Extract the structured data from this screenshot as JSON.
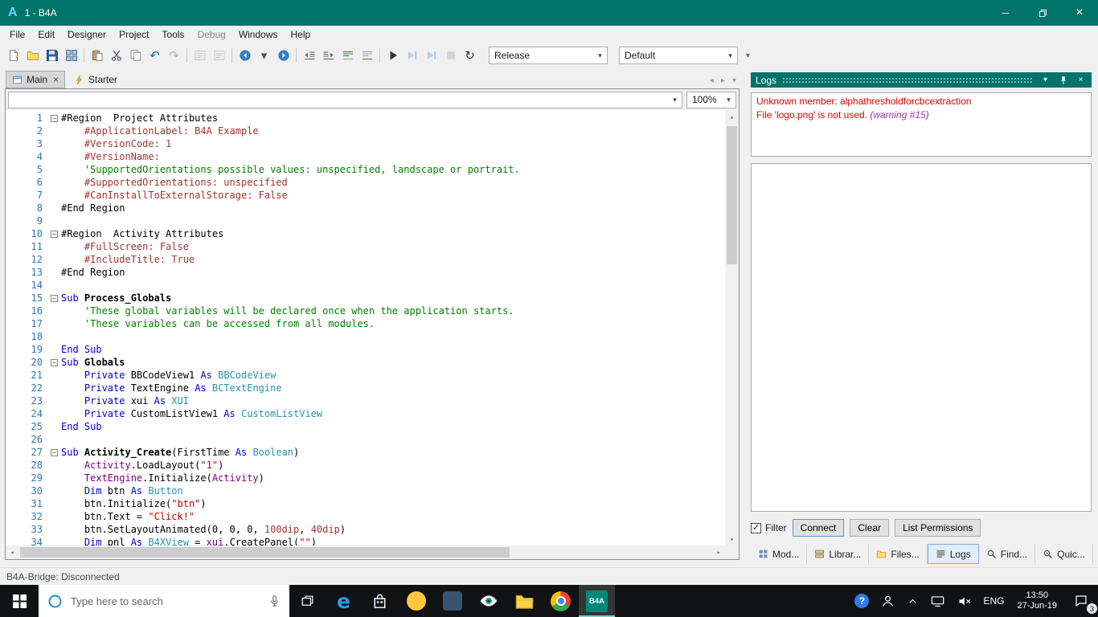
{
  "window": {
    "logo_letter": "A",
    "title": "1 - B4A"
  },
  "menubar": {
    "items": [
      {
        "label": "File"
      },
      {
        "label": "Edit"
      },
      {
        "label": "Designer"
      },
      {
        "label": "Project"
      },
      {
        "label": "Tools"
      },
      {
        "label": "Debug",
        "dim": true
      },
      {
        "label": "Windows"
      },
      {
        "label": "Help"
      }
    ]
  },
  "toolbar": {
    "items": [
      {
        "name": "new-module-button",
        "icon": "page"
      },
      {
        "name": "open-project-button",
        "icon": "folder"
      },
      {
        "name": "save-button",
        "icon": "floppy"
      },
      {
        "name": "save-all-button",
        "icon": "grid"
      },
      {
        "sep": true
      },
      {
        "name": "paste-button",
        "icon": "paste"
      },
      {
        "name": "cut-button",
        "icon": "cut"
      },
      {
        "name": "copy-button",
        "icon": "copy"
      },
      {
        "name": "undo-button",
        "glyph": "↶",
        "color": "#1565C0"
      },
      {
        "name": "redo-button",
        "glyph": "↷",
        "color": "#A9B4C0"
      },
      {
        "sep": true
      },
      {
        "name": "find-button",
        "icon": "findbook",
        "dim": true
      },
      {
        "name": "replace-button",
        "icon": "findbook",
        "dim": true
      },
      {
        "sep": true
      },
      {
        "name": "navigate-back-button",
        "icon": "back"
      },
      {
        "name": "navigate-back-menu",
        "glyph": "▾",
        "color": "#555555"
      },
      {
        "name": "navigate-forward-button",
        "icon": "forward"
      },
      {
        "sep": true
      },
      {
        "name": "outdent-button",
        "icon": "outdent"
      },
      {
        "name": "indent-button",
        "icon": "indent"
      },
      {
        "name": "comment-button",
        "icon": "comment"
      },
      {
        "name": "uncomment-button",
        "icon": "uncomment"
      },
      {
        "sep": true
      },
      {
        "name": "run-button",
        "icon": "play"
      },
      {
        "name": "resume-button",
        "icon": "resume",
        "dim": true
      },
      {
        "name": "step-button",
        "icon": "resume",
        "dim": true
      },
      {
        "name": "stop-button",
        "icon": "stop",
        "dim": true
      },
      {
        "name": "rebuild-button",
        "glyph": "↻",
        "color": "#333333"
      }
    ],
    "release_value": "Release",
    "default_value": "Default"
  },
  "tabs": {
    "items": [
      {
        "label": "Main",
        "active": true,
        "icon": "formicon",
        "close": true
      },
      {
        "label": "Starter",
        "active": false,
        "icon": "lightning"
      }
    ]
  },
  "editor": {
    "nav_value": "",
    "zoom": "100%",
    "lines": [
      {
        "n": 1,
        "fold": true,
        "t": [
          [
            "p",
            "#Region  Project Attributes"
          ]
        ]
      },
      {
        "n": 2,
        "t": [
          [
            "a",
            "    #ApplicationLabel: B4A Example"
          ]
        ]
      },
      {
        "n": 3,
        "t": [
          [
            "a",
            "    #VersionCode: 1"
          ]
        ]
      },
      {
        "n": 4,
        "t": [
          [
            "a",
            "    #VersionName: "
          ]
        ]
      },
      {
        "n": 5,
        "t": [
          [
            "c",
            "    'SupportedOrientations possible values: unspecified, landscape or portrait."
          ]
        ]
      },
      {
        "n": 6,
        "t": [
          [
            "a",
            "    #SupportedOrientations: unspecified"
          ]
        ]
      },
      {
        "n": 7,
        "t": [
          [
            "a",
            "    #CanInstallToExternalStorage: False"
          ]
        ]
      },
      {
        "n": 8,
        "t": [
          [
            "p",
            "#End Region"
          ]
        ]
      },
      {
        "n": 9,
        "t": []
      },
      {
        "n": 10,
        "fold": true,
        "t": [
          [
            "p",
            "#Region  Activity Attributes"
          ]
        ]
      },
      {
        "n": 11,
        "t": [
          [
            "a",
            "    #FullScreen: False"
          ]
        ]
      },
      {
        "n": 12,
        "t": [
          [
            "a",
            "    #IncludeTitle: True"
          ]
        ]
      },
      {
        "n": 13,
        "t": [
          [
            "p",
            "#End Region"
          ]
        ]
      },
      {
        "n": 14,
        "t": []
      },
      {
        "n": 15,
        "fold": true,
        "t": [
          [
            "k",
            "Sub "
          ],
          [
            "b",
            "Process_Globals"
          ]
        ]
      },
      {
        "n": 16,
        "t": [
          [
            "c",
            "    'These global variables will be declared once when the application starts."
          ]
        ]
      },
      {
        "n": 17,
        "t": [
          [
            "c",
            "    'These variables can be accessed from all modules."
          ]
        ]
      },
      {
        "n": 18,
        "t": []
      },
      {
        "n": 19,
        "t": [
          [
            "k",
            "End Sub"
          ]
        ]
      },
      {
        "n": 20,
        "fold": true,
        "t": [
          [
            "k",
            "Sub "
          ],
          [
            "b",
            "Globals"
          ]
        ]
      },
      {
        "n": 21,
        "t": [
          [
            "k",
            "    Private "
          ],
          [
            "p",
            "BBCodeView1 "
          ],
          [
            "k",
            "As "
          ],
          [
            "t",
            "BBCodeView"
          ]
        ]
      },
      {
        "n": 22,
        "t": [
          [
            "k",
            "    Private "
          ],
          [
            "p",
            "TextEngine "
          ],
          [
            "k",
            "As "
          ],
          [
            "t",
            "BCTextEngine"
          ]
        ]
      },
      {
        "n": 23,
        "t": [
          [
            "k",
            "    Private "
          ],
          [
            "p",
            "xui "
          ],
          [
            "k",
            "As "
          ],
          [
            "t",
            "XUI"
          ]
        ]
      },
      {
        "n": 24,
        "t": [
          [
            "k",
            "    Private "
          ],
          [
            "p",
            "CustomListView1 "
          ],
          [
            "k",
            "As "
          ],
          [
            "t",
            "CustomListView"
          ]
        ]
      },
      {
        "n": 25,
        "t": [
          [
            "k",
            "End Sub"
          ]
        ]
      },
      {
        "n": 26,
        "t": []
      },
      {
        "n": 27,
        "fold": true,
        "t": [
          [
            "k",
            "Sub "
          ],
          [
            "b",
            "Activity_Create"
          ],
          [
            "p",
            "(FirstTime "
          ],
          [
            "k",
            "As "
          ],
          [
            "t",
            "Boolean"
          ],
          [
            "p",
            ")"
          ]
        ]
      },
      {
        "n": 28,
        "t": [
          [
            "o",
            "    Activity"
          ],
          [
            "p",
            ".LoadLayout("
          ],
          [
            "s",
            "\"1\""
          ],
          [
            "p",
            ")"
          ]
        ]
      },
      {
        "n": 29,
        "t": [
          [
            "o",
            "    TextEngine"
          ],
          [
            "p",
            ".Initialize("
          ],
          [
            "o",
            "Activity"
          ],
          [
            "p",
            ")"
          ]
        ]
      },
      {
        "n": 30,
        "t": [
          [
            "k",
            "    Dim "
          ],
          [
            "p",
            "btn "
          ],
          [
            "k",
            "As "
          ],
          [
            "t",
            "Button"
          ]
        ]
      },
      {
        "n": 31,
        "t": [
          [
            "p",
            "    btn.Initialize("
          ],
          [
            "s",
            "\"btn\""
          ],
          [
            "p",
            ")"
          ]
        ]
      },
      {
        "n": 32,
        "t": [
          [
            "p",
            "    btn.Text = "
          ],
          [
            "s",
            "\"Click!\""
          ]
        ]
      },
      {
        "n": 33,
        "t": [
          [
            "p",
            "    btn.SetLayoutAnimated(0, 0, 0, "
          ],
          [
            "num",
            "100dip"
          ],
          [
            "p",
            ", "
          ],
          [
            "num",
            "40dip"
          ],
          [
            "p",
            ")"
          ]
        ]
      },
      {
        "n": 34,
        "t": [
          [
            "k",
            "    Dim "
          ],
          [
            "p",
            "pnl "
          ],
          [
            "k",
            "As "
          ],
          [
            "t",
            "B4XView"
          ],
          [
            "p",
            " = "
          ],
          [
            "o",
            "xui"
          ],
          [
            "p",
            ".CreatePanel("
          ],
          [
            "s",
            "\"\""
          ],
          [
            "p",
            ")"
          ]
        ]
      }
    ]
  },
  "logs": {
    "title": "Logs",
    "messages": [
      {
        "text": "Unknown member: alphathresholdforcbcextraction",
        "suffix": ""
      },
      {
        "text": "File 'logo.png' is not used. ",
        "suffix": "(warning #15)"
      }
    ],
    "filter_label": "Filter",
    "filter_checked": true,
    "buttons": [
      {
        "label": "Connect",
        "name": "connect-button"
      },
      {
        "label": "Clear",
        "name": "clear-button"
      },
      {
        "label": "List Permissions",
        "name": "list-permissions-button"
      }
    ],
    "panel_tabs": [
      {
        "label": "Mod...",
        "icon": "modules",
        "name": "panel-tab-modules"
      },
      {
        "label": "Librar...",
        "icon": "libraries",
        "name": "panel-tab-libraries"
      },
      {
        "label": "Files...",
        "icon": "folder",
        "name": "panel-tab-files"
      },
      {
        "label": "Logs",
        "icon": "logslines",
        "name": "panel-tab-logs",
        "active": true
      },
      {
        "label": "Find...",
        "icon": "find",
        "name": "panel-tab-find"
      },
      {
        "label": "Quic...",
        "icon": "quick",
        "name": "panel-tab-quick"
      }
    ]
  },
  "statusbar": {
    "text": "B4A-Bridge: Disconnected"
  },
  "taskbar": {
    "search_placeholder": "Type here to search",
    "language": "ENG",
    "time": "13:50",
    "date": "27-Jun-19",
    "badge": "3",
    "b4a_label": "B4A",
    "apps": [
      {
        "name": "edge"
      },
      {
        "name": "store"
      },
      {
        "name": "yellow-app"
      },
      {
        "name": "blue-app"
      },
      {
        "name": "eye"
      },
      {
        "name": "explorer"
      },
      {
        "name": "chrome"
      },
      {
        "name": "b4a",
        "active": true
      }
    ],
    "tray_icons": [
      "help",
      "people",
      "chevron-up",
      "network",
      "volume"
    ]
  }
}
